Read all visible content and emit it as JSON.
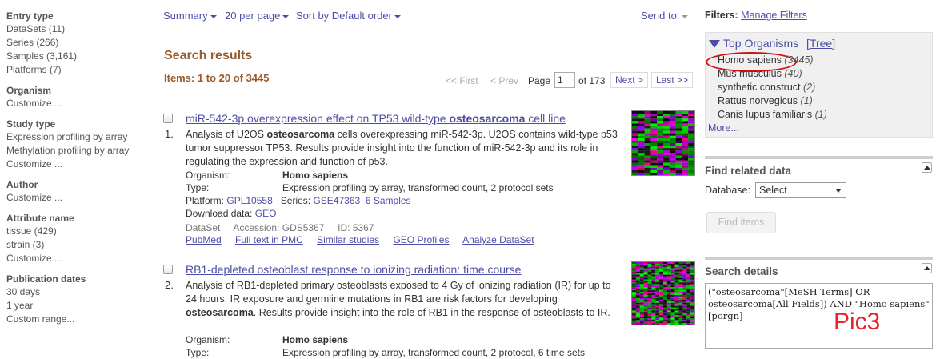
{
  "sidebar": {
    "entry_type": {
      "heading": "Entry type",
      "items": [
        "DataSets (11)",
        "Series (266)",
        "Samples (3,161)",
        "Platforms (7)"
      ]
    },
    "organism": {
      "heading": "Organism",
      "customize": "Customize ..."
    },
    "study_type": {
      "heading": "Study type",
      "items": [
        "Expression profiling by array",
        "Methylation profiling by array"
      ],
      "customize": "Customize ..."
    },
    "author": {
      "heading": "Author",
      "customize": "Customize ..."
    },
    "attribute_name": {
      "heading": "Attribute name",
      "items": [
        "tissue (429)",
        "strain (3)"
      ],
      "customize": "Customize ..."
    },
    "publication_dates": {
      "heading": "Publication dates",
      "items": [
        "30 days",
        "1 year",
        "Custom range..."
      ]
    }
  },
  "toolbar": {
    "summary": "Summary",
    "per_page": "20 per page",
    "sort": "Sort by Default order",
    "send_to": "Send to:"
  },
  "results": {
    "title": "Search results",
    "items_label": "Items: 1 to 20 of 3445"
  },
  "pager": {
    "first": "<< First",
    "prev": "< Prev",
    "page_label": "Page",
    "page_value": "1",
    "of_label": "of 173",
    "next": "Next >",
    "last": "Last >>"
  },
  "result1": {
    "number": "1.",
    "title_before": "miR-542-3p overexpression effect on TP53 wild-type ",
    "title_bold": "osteosarcoma",
    "title_after": " cell line",
    "desc_1": "Analysis of U2OS ",
    "desc_bold": "osteosarcoma",
    "desc_2": " cells overexpressing miR-542-3p. U2OS contains wild-type p53 tumor suppressor TP53. Results provide insight into the function of miR-542-3p and its role in regulating the expression and function of p53.",
    "organism_label": "Organism:",
    "organism_value": "Homo sapiens",
    "type_label": "Type:",
    "type_value": "Expression profiling by array, transformed count, 2 protocol sets",
    "platform_label": "Platform:",
    "platform_value": "GPL10558",
    "series_label": "Series:",
    "series_value": "GSE47363",
    "samples": "6 Samples",
    "download_label": "Download data:",
    "download_value": "GEO",
    "dataset_label": "DataSet",
    "accession_label": "Accession:",
    "accession_value": "GDS5367",
    "id_label": "ID:",
    "id_value": "5367",
    "links": [
      "PubMed",
      "Full text in PMC",
      "Similar studies",
      "GEO Profiles",
      "Analyze DataSet"
    ]
  },
  "result2": {
    "number": "2.",
    "title": "RB1-depleted osteoblast response to ionizing radiation: time course",
    "desc_1": "Analysis of RB1-depleted primary osteoblasts exposed to 4 Gy of ionizing radiation (IR) for up to 24 hours. IR exposure and germline mutations in RB1 are risk factors for developing ",
    "desc_bold": "osteosarcoma",
    "desc_2": ". Results provide insight into the role of RB1 in the response of osteoblasts to IR.",
    "organism_label": "Organism:",
    "organism_value": "Homo sapiens",
    "type_label": "Type:",
    "type_value": "Expression profiling by array, transformed count, 2 protocol, 6 time sets"
  },
  "filters": {
    "label": "Filters:",
    "manage": "Manage Filters"
  },
  "top_organisms": {
    "title": "Top Organisms",
    "tree": "[Tree]",
    "items": [
      {
        "name": "Homo sapiens",
        "count": "(3445)"
      },
      {
        "name": "Mus musculus",
        "count": "(40)"
      },
      {
        "name": "synthetic construct",
        "count": "(2)"
      },
      {
        "name": "Rattus norvegicus",
        "count": "(1)"
      },
      {
        "name": "Canis lupus familiaris",
        "count": "(1)"
      }
    ],
    "more": "More..."
  },
  "find_related": {
    "title": "Find related data",
    "db_label": "Database:",
    "db_value": "Select",
    "button": "Find items"
  },
  "search_details": {
    "title": "Search details",
    "query": "(\"osteosarcoma\"[MeSH Terms] OR osteosarcoma[All Fields]) AND \"Homo sapiens\"[porgn]",
    "annotation": "Pic3"
  },
  "colors": {
    "link": "#4d4da6",
    "heading_brown": "#9a5a2b",
    "highlight_ring": "#d01010",
    "annotation": "#e8232a"
  }
}
